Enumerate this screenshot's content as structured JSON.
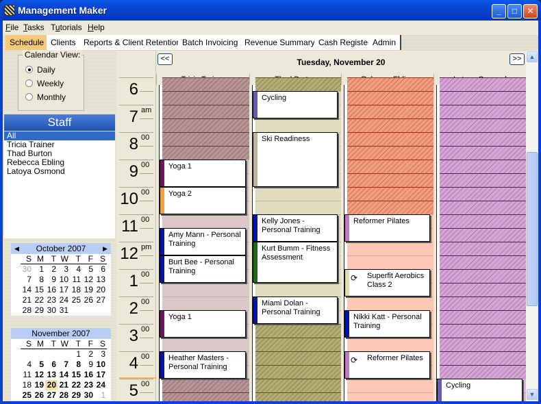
{
  "window": {
    "title": "Management Maker",
    "controls": [
      "minimize",
      "maximize",
      "close"
    ]
  },
  "menu": [
    {
      "label": "File",
      "accel": "F",
      "rest": "ile"
    },
    {
      "label": "Tasks",
      "accel": "T",
      "rest": "asks"
    },
    {
      "label": "Tutorials",
      "pre": "T",
      "accel": "u",
      "rest": "torials"
    },
    {
      "label": "Help",
      "accel": "H",
      "rest": "elp"
    }
  ],
  "tabs": [
    {
      "label": "Schedule",
      "active": true
    },
    {
      "label": "Clients"
    },
    {
      "label": "Reports & Client Retention"
    },
    {
      "label": "Batch Invoicing"
    },
    {
      "label": "Revenue Summary"
    },
    {
      "label": "Cash Register"
    },
    {
      "label": "Admin"
    }
  ],
  "calendar_view": {
    "legend": "Calendar View:",
    "options": [
      "Daily",
      "Weekly",
      "Monthly"
    ],
    "selected": "Daily"
  },
  "staff": {
    "header": "Staff",
    "items": [
      "All",
      "Tricia Trainer",
      "Thad Burton",
      "Rebecca Ebling",
      "Latoya Osmond"
    ],
    "selected": "All"
  },
  "mini_calendars": [
    {
      "title": "October 2007",
      "dow": [
        "S",
        "M",
        "T",
        "W",
        "T",
        "F",
        "S"
      ],
      "prev_icon": "left-triangle",
      "next_icon": "right-triangle",
      "days": [
        {
          "d": "30",
          "c": "grey"
        },
        {
          "d": "1"
        },
        {
          "d": "2"
        },
        {
          "d": "3"
        },
        {
          "d": "4"
        },
        {
          "d": "5"
        },
        {
          "d": "6"
        },
        {
          "d": "7"
        },
        {
          "d": "8"
        },
        {
          "d": "9"
        },
        {
          "d": "10"
        },
        {
          "d": "11"
        },
        {
          "d": "12"
        },
        {
          "d": "13"
        },
        {
          "d": "14"
        },
        {
          "d": "15"
        },
        {
          "d": "16"
        },
        {
          "d": "17"
        },
        {
          "d": "18"
        },
        {
          "d": "19"
        },
        {
          "d": "20"
        },
        {
          "d": "21"
        },
        {
          "d": "22"
        },
        {
          "d": "23"
        },
        {
          "d": "24"
        },
        {
          "d": "25"
        },
        {
          "d": "26"
        },
        {
          "d": "27"
        },
        {
          "d": "28"
        },
        {
          "d": "29"
        },
        {
          "d": "30"
        },
        {
          "d": "31"
        }
      ]
    },
    {
      "title": "November 2007",
      "dow": [
        "S",
        "M",
        "T",
        "W",
        "T",
        "F",
        "S"
      ],
      "days": [
        {
          "d": ""
        },
        {
          "d": ""
        },
        {
          "d": ""
        },
        {
          "d": ""
        },
        {
          "d": "1"
        },
        {
          "d": "2"
        },
        {
          "d": "3"
        },
        {
          "d": "4"
        },
        {
          "d": "5",
          "c": "bold"
        },
        {
          "d": "6",
          "c": "bold"
        },
        {
          "d": "7",
          "c": "bold"
        },
        {
          "d": "8",
          "c": "bold"
        },
        {
          "d": "9"
        },
        {
          "d": "10",
          "c": "bold"
        },
        {
          "d": "11"
        },
        {
          "d": "12",
          "c": "bold"
        },
        {
          "d": "13",
          "c": "bold"
        },
        {
          "d": "14",
          "c": "bold"
        },
        {
          "d": "15",
          "c": "bold"
        },
        {
          "d": "16",
          "c": "bold"
        },
        {
          "d": "17",
          "c": "bold"
        },
        {
          "d": "18"
        },
        {
          "d": "19",
          "c": "bold"
        },
        {
          "d": "20",
          "c": "bold today"
        },
        {
          "d": "21",
          "c": "bold"
        },
        {
          "d": "22",
          "c": "bold"
        },
        {
          "d": "23",
          "c": "bold"
        },
        {
          "d": "24",
          "c": "bold"
        },
        {
          "d": "25",
          "c": "bold"
        },
        {
          "d": "26",
          "c": "bold"
        },
        {
          "d": "27",
          "c": "bold"
        },
        {
          "d": "28",
          "c": "bold"
        },
        {
          "d": "29",
          "c": "bold"
        },
        {
          "d": "30",
          "c": "bold"
        },
        {
          "d": "1",
          "c": "grey"
        }
      ]
    }
  ],
  "schedule": {
    "date_title": "Tuesday, November 20",
    "prev_label": "<<",
    "next_label": ">>",
    "hours": [
      {
        "num": "6",
        "sfx": ""
      },
      {
        "num": "7",
        "sfx": "am"
      },
      {
        "num": "8",
        "sfx": "00"
      },
      {
        "num": "9",
        "sfx": "00"
      },
      {
        "num": "10",
        "sfx": "00"
      },
      {
        "num": "11",
        "sfx": "00"
      },
      {
        "num": "12",
        "sfx": "pm"
      },
      {
        "num": "1",
        "sfx": "00"
      },
      {
        "num": "2",
        "sfx": "00"
      },
      {
        "num": "3",
        "sfx": "00"
      },
      {
        "num": "4",
        "sfx": "00"
      },
      {
        "num": "5",
        "sfx": "00"
      }
    ],
    "current_time": "5:00 pm",
    "staff_columns": [
      {
        "name": "Tricia Trainer",
        "available_color": "#dcc8c8",
        "unavailable_color": "#b89494",
        "line_color": "#5a3a3a",
        "unavailable_ranges": [
          [
            6.0,
            9.0
          ],
          [
            17.0,
            18.0
          ]
        ],
        "appointments": [
          {
            "title": "Yoga 1",
            "start": 9.0,
            "end": 10.0,
            "color": "#6b1a5a"
          },
          {
            "title": "Yoga 2",
            "start": 10.0,
            "end": 11.0,
            "color": "#f0a040"
          },
          {
            "title": "Amy Mann - Personal Training",
            "start": 11.5,
            "end": 12.5,
            "color": "#0a14a0"
          },
          {
            "title": "Burt Bee - Personal Training",
            "start": 12.5,
            "end": 13.5,
            "color": "#0a14a0"
          },
          {
            "title": "Yoga 1",
            "start": 14.5,
            "end": 15.5,
            "color": "#6b1a5a"
          },
          {
            "title": "Heather Masters - Personal Training",
            "start": 16.0,
            "end": 17.0,
            "color": "#0a14a0"
          }
        ]
      },
      {
        "name": "Thad Burton",
        "available_color": "#e0dcc0",
        "unavailable_color": "#b4ac74",
        "line_color": "#5a5420",
        "unavailable_ranges": [
          [
            6.0,
            6.5
          ],
          [
            15.0,
            18.0
          ]
        ],
        "appointments": [
          {
            "title": "Cycling",
            "start": 6.5,
            "end": 7.5,
            "color": "#6a5ab0"
          },
          {
            "title": "Ski Readiness",
            "start": 8.0,
            "end": 10.0,
            "color": "#c0b49c"
          },
          {
            "title": "Kelly Jones - Personal Training",
            "start": 11.0,
            "end": 12.0,
            "color": "#0a14a0"
          },
          {
            "title": "Kurt Bumm - Fitness Assessment",
            "start": 12.0,
            "end": 13.5,
            "color": "#1a6a1a"
          },
          {
            "title": "Miami Dolan - Personal Training",
            "start": 14.0,
            "end": 15.0,
            "color": "#0a14a0"
          }
        ]
      },
      {
        "name": "Rebecca Ebling",
        "available_color": "#fcc8b4",
        "unavailable_color": "#f49c7c",
        "line_color": "#a02a0a",
        "unavailable_ranges": [
          [
            6.0,
            11.0
          ]
        ],
        "appointments": [
          {
            "title": "Reformer Pilates",
            "start": 11.0,
            "end": 12.0,
            "color": "#c07ac0"
          },
          {
            "title": "Superfit Aerobics Class 2",
            "start": 13.0,
            "end": 14.0,
            "color": "#e0dcb0",
            "recurring": true
          },
          {
            "title": "Nikki Katt - Personal Training",
            "start": 14.5,
            "end": 15.5,
            "color": "#0a14a0"
          },
          {
            "title": "Reformer Pilates",
            "start": 16.0,
            "end": 17.0,
            "color": "#c07ac0",
            "recurring": true
          }
        ]
      },
      {
        "name": "Latoya Osmond",
        "available_color": "#e0b4e0",
        "unavailable_color": "#d8a4d8",
        "line_color": "#5a1a5a",
        "unavailable_ranges": [
          [
            6.0,
            17.0
          ]
        ],
        "appointments": [
          {
            "title": "Cycling",
            "start": 17.0,
            "end": 18.0,
            "color": "#6a5ab0"
          }
        ]
      }
    ]
  },
  "icons": {
    "recurring": "⟳",
    "scroll_up": "▲",
    "scroll_down": "▼"
  }
}
